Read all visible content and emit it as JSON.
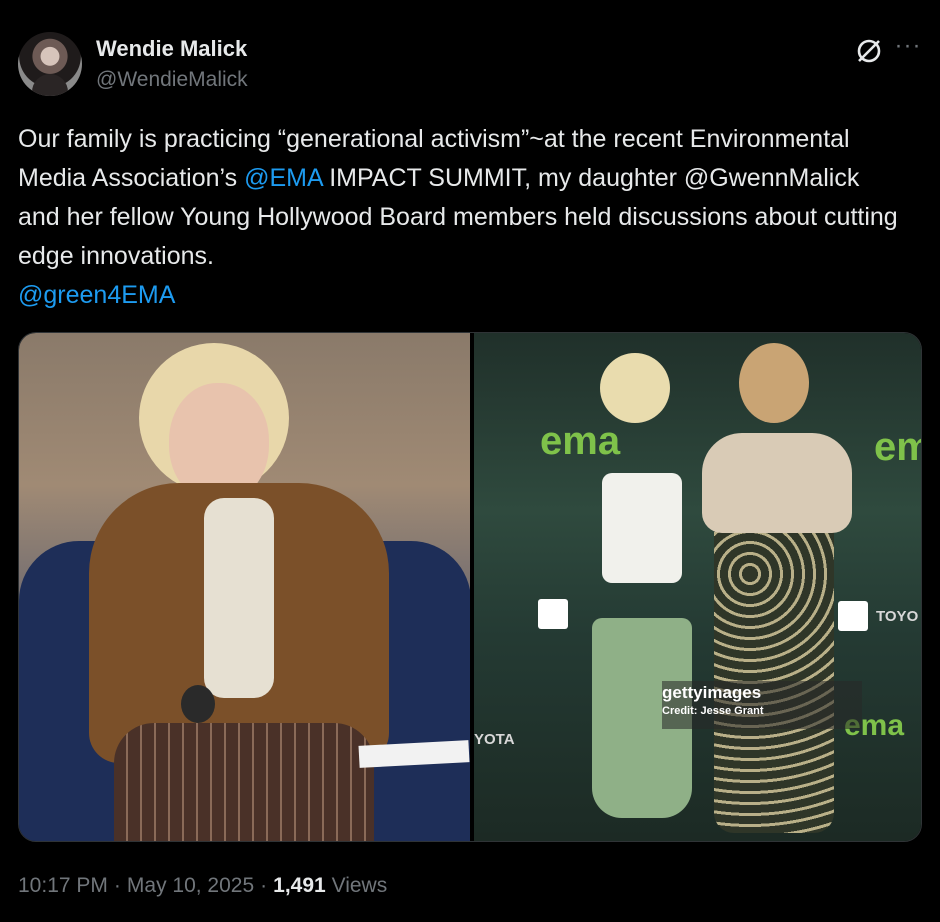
{
  "author": {
    "name": "Wendie Malick",
    "handle": "@WendieMalick"
  },
  "tweet": {
    "segments": [
      {
        "text": "Our family is practicing “generational activism”~at the recent Environmental Media Association’s ",
        "type": "text"
      },
      {
        "text": "@EMA",
        "type": "mention"
      },
      {
        "text": " IMPACT SUMMIT, my daughter @GwennMalick and her fellow Young Hollywood Board members held discussions about cutting edge innovations.",
        "type": "text"
      },
      {
        "text": "@green4EMA",
        "type": "mention",
        "newline": true
      }
    ]
  },
  "media": {
    "right_photo": {
      "logo_text": "ema",
      "sponsor_text": "TOYO",
      "sponsor_text_left": "YOTA",
      "watermark_brand": "gettyimages",
      "watermark_credit": "Credit: Jesse Grant"
    }
  },
  "footer": {
    "time": "10:17 PM",
    "sep1": "·",
    "date": "May 10, 2025",
    "sep2": "·",
    "views_count": "1,491",
    "views_label": "Views"
  },
  "icons": {
    "grok": "grok-icon",
    "more": "more-icon"
  },
  "colors": {
    "background": "#000000",
    "text": "#e7e9ea",
    "secondary": "#71767b",
    "link": "#1d9bf0"
  }
}
